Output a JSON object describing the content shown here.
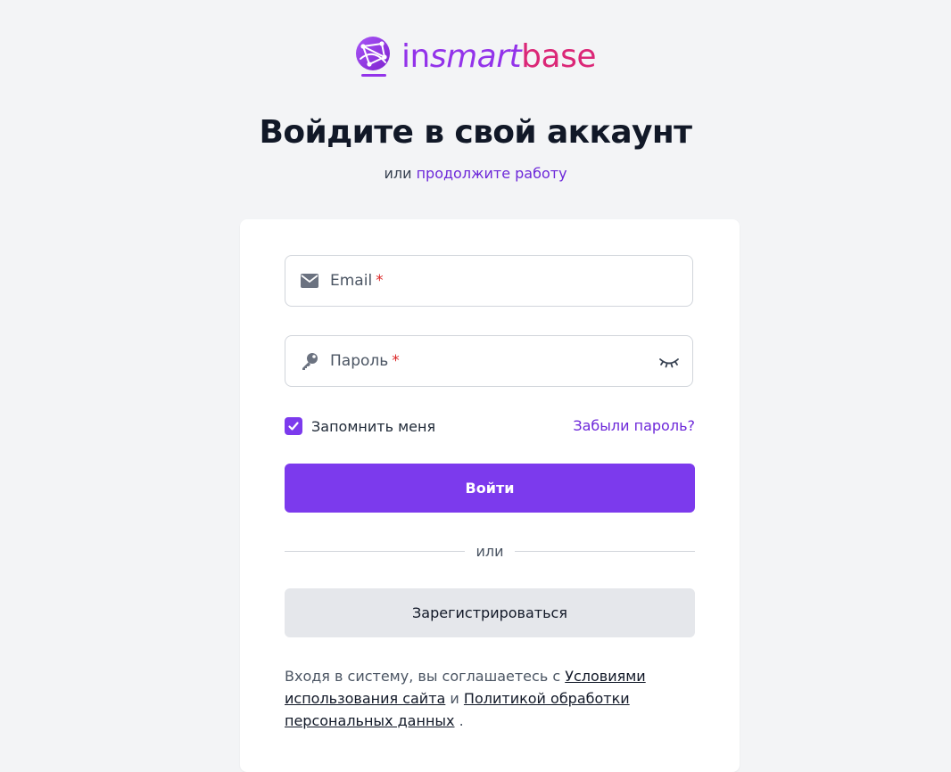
{
  "logo": {
    "text_in": "in",
    "text_smart": "smart",
    "text_base": "base",
    "icon": "globe-network-icon"
  },
  "heading": "Войдите в свой аккаунт",
  "subtitle": {
    "prefix": "или",
    "link": "продолжите работу"
  },
  "form": {
    "email": {
      "placeholder": "Email",
      "required_mark": "*",
      "icon": "mail-icon"
    },
    "password": {
      "placeholder": "Пароль",
      "required_mark": "*",
      "icon": "key-icon",
      "toggle_icon": "eye-closed-icon"
    },
    "remember_label": "Запомнить меня",
    "remember_checked": true,
    "forgot_link": "Забыли пароль?",
    "login_button": "Войти",
    "divider_text": "или",
    "register_button": "Зарегистрироваться"
  },
  "terms": {
    "prefix": "Входя в систему, вы соглашаетесь с",
    "link_terms": "Условиями использования сайта",
    "middle": "и",
    "link_privacy": "Политикой обработки персональных данных",
    "suffix": "."
  },
  "colors": {
    "accent": "#7c3aed",
    "link": "#6d28d9",
    "logo_purple": "#9333ea",
    "logo_pink": "#db2777",
    "required": "#dc2626",
    "background": "#f3f4f6"
  }
}
